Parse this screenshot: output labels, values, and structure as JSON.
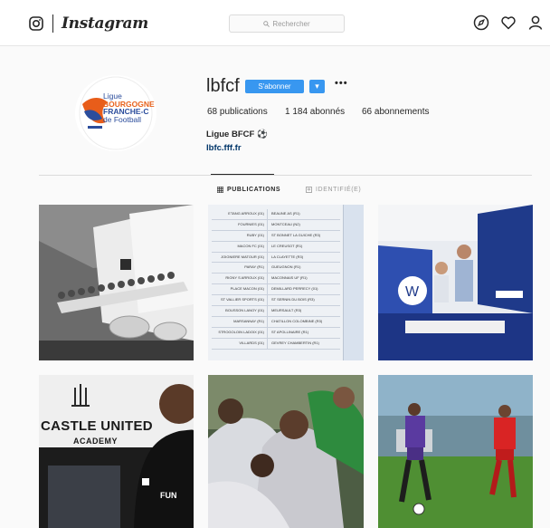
{
  "header": {
    "brand": "Instagram",
    "search_placeholder": "Rechercher",
    "icons": [
      "instagram-camera-icon",
      "explore-compass-icon",
      "heart-icon",
      "profile-person-icon"
    ]
  },
  "profile": {
    "username": "lbfcf",
    "follow_label": "S'abonner",
    "more_label": "▾",
    "options_label": "•••",
    "stats": {
      "posts": "68 publications",
      "followers": "1 184 abonnés",
      "following": "66 abonnements"
    },
    "full_name": "Ligue BFCF",
    "full_name_emoji": "⚽",
    "website": "lbfc.fff.fr",
    "avatar_logo": {
      "line1": "Ligue",
      "line2": "BOURGOGNE",
      "line3": "FRANCHE-C",
      "line4": "de Football"
    }
  },
  "tabs": [
    {
      "label": "PUBLICATIONS",
      "icon": "grid-icon",
      "active": true
    },
    {
      "label": "IDENTIFIÉ(E)",
      "icon": "tag-icon",
      "active": false
    }
  ],
  "posts": {
    "table_rows": [
      [
        "ETANG ARROUX (01)",
        "BEAUNE AS (R1)"
      ],
      [
        "FOURNIES (01)",
        "MONTCEAU (N2)"
      ],
      [
        "RUBY (01)",
        "ST BONNET LA GUICHE (R3)"
      ],
      [
        "MACON FC (01)",
        "LE CREUSOT (R1)"
      ],
      [
        "JOIGNIERE MATOUR (01)",
        "LA CLAYETTE (R3)"
      ],
      [
        "PARAY (R1)",
        "GUEUGNON (R1)"
      ],
      [
        "RIGNY S ARROUX (01)",
        "MACONNAIS UF (R1)"
      ],
      [
        "PLACE MACON (01)",
        "DEMILLARD PERRECY (01)"
      ],
      [
        "ST VALLIER SPORTS (01)",
        "ST SERNIN DU BOIS (R3)"
      ],
      [
        "BOUSSON LANOY (01)",
        "MEURSAULT (R3)"
      ],
      [
        "MARSANNAY (R1)",
        "CHATILLON COLOMBINE (R3)"
      ],
      [
        "STROGOLOIN LADOIX (01)",
        "ST APOLLINAIRE (R1)"
      ],
      [
        "VILLARDS (01)",
        "GEVREY CHAMBERTIN (R1)"
      ]
    ],
    "tile4_text": "CASTLE UNITED",
    "tile4_sub": "ACADEMY",
    "tile4_shirt": "FUN"
  }
}
